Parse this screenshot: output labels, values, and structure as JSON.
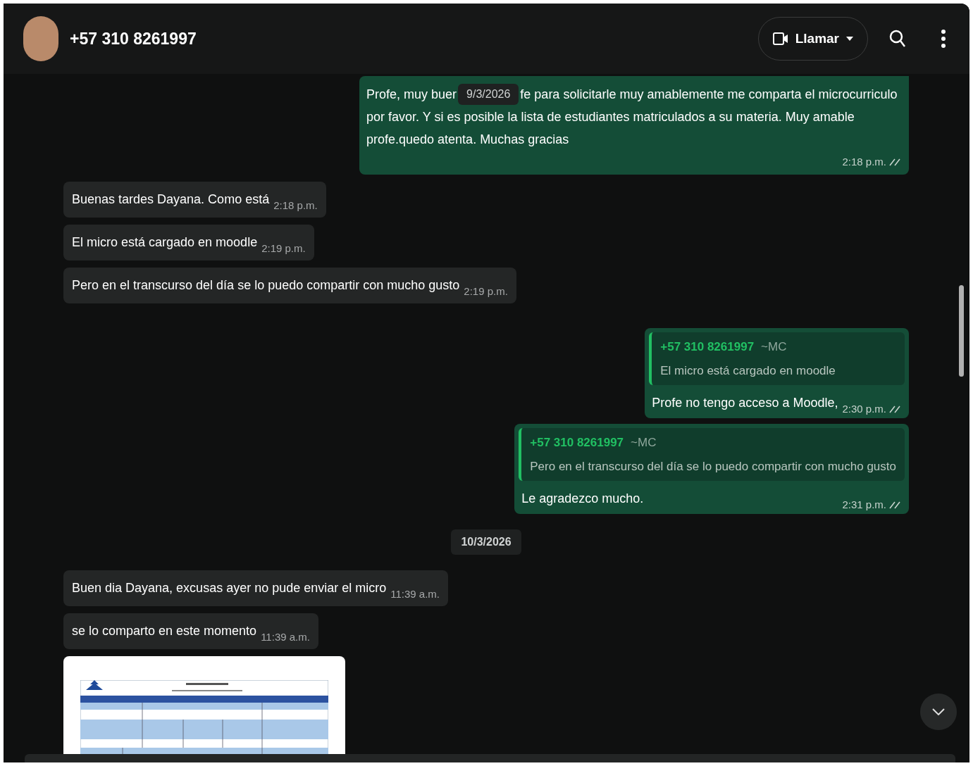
{
  "header": {
    "contact_name": "+57 310 8261997",
    "call_button": "Llamar"
  },
  "sticky_date": "9/3/2026",
  "messages": [
    {
      "kind": "out",
      "lines": [
        {
          "before": "Profe, muy buer",
          "after": "fe para solicitarle muy amablemente me comparta el microcurriculo"
        },
        {
          "text": "por favor. Y si es posible la lista de estudiantes matriculados a su materia. Muy amable"
        },
        {
          "text": "profe.quedo atenta. Muchas gracias"
        }
      ],
      "time": "2:18 p.m."
    },
    {
      "kind": "in",
      "text": "Buenas tardes Dayana. Como está",
      "time": "2:18 p.m."
    },
    {
      "kind": "in",
      "text": "El micro está cargado en moodle",
      "time": "2:19 p.m."
    },
    {
      "kind": "in",
      "text": "Pero en el transcurso del día se lo puedo compartir con mucho gusto",
      "time": "2:19 p.m."
    },
    {
      "kind": "out_reply",
      "quote": {
        "author": "+57 310 8261997",
        "alias": "~MC",
        "text": "El micro está cargado en moodle"
      },
      "text": "Profe no tengo acceso a Moodle,",
      "time": "2:30 p.m."
    },
    {
      "kind": "out_reply",
      "quote": {
        "author": "+57 310 8261997",
        "alias": "~MC",
        "text": "Pero en el transcurso del día se lo puedo compartir con mucho gusto"
      },
      "text": "Le agradezco mucho.",
      "time": "2:31 p.m."
    },
    {
      "kind": "date",
      "text": "10/3/2026"
    },
    {
      "kind": "in",
      "text": "Buen dia Dayana, excusas ayer no pude enviar el micro",
      "time": "11:39 a.m."
    },
    {
      "kind": "in",
      "text": "se lo comparto en este momento",
      "time": "11:39 a.m."
    },
    {
      "kind": "document"
    }
  ]
}
